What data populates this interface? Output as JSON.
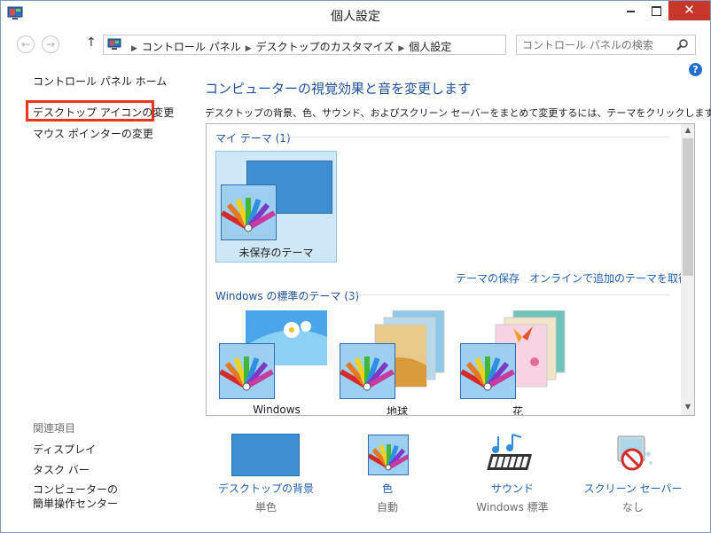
{
  "window": {
    "title": "個人設定"
  },
  "titlebar": {
    "close_glyph": "✕"
  },
  "nav": {
    "back_glyph": "←",
    "forward_glyph": "→",
    "up_glyph": "↑",
    "refresh_glyph": "↻"
  },
  "address": {
    "crumbs": [
      "コントロール パネル",
      "デスクトップのカスタマイズ",
      "個人設定"
    ],
    "separator": "▶",
    "dropdown_glyph": "▼"
  },
  "search": {
    "placeholder": "コントロール パネルの検索"
  },
  "sidebar": {
    "home": "コントロール パネル ホーム",
    "links": [
      "デスクトップ アイコンの変更",
      "マウス ポインターの変更"
    ],
    "related_heading": "関連項目",
    "related": [
      "ディスプレイ",
      "タスク バー",
      "コンピューターの",
      "簡単操作センター"
    ]
  },
  "help": {
    "glyph": "?"
  },
  "main": {
    "title": "コンピューターの視覚効果と音を変更します",
    "description": "デスクトップの背景、色、サウンド、およびスクリーン セーバーをまとめて変更するには、テーマをクリックします。",
    "my_themes_heading": "マイ テーマ (1)",
    "my_theme_label": "未保存のテーマ",
    "save_theme_link": "テーマの保存",
    "online_themes_link": "オンラインで追加のテーマを取得",
    "windows_themes_heading": "Windows の標準のテーマ (3)",
    "windows_themes": [
      "Windows",
      "地球",
      "花"
    ],
    "scroll_up_glyph": "▲",
    "scroll_down_glyph": "▼"
  },
  "bottom": [
    {
      "label": "デスクトップの背景",
      "value": "単色"
    },
    {
      "label": "色",
      "value": "自動"
    },
    {
      "label": "サウンド",
      "value": "Windows 標準"
    },
    {
      "label": "スクリーン セーバー",
      "value": "なし"
    }
  ],
  "colors": {
    "accent_blue": "#1e5fb4",
    "highlight_red": "#e8351d",
    "close_red": "#c7362a"
  }
}
